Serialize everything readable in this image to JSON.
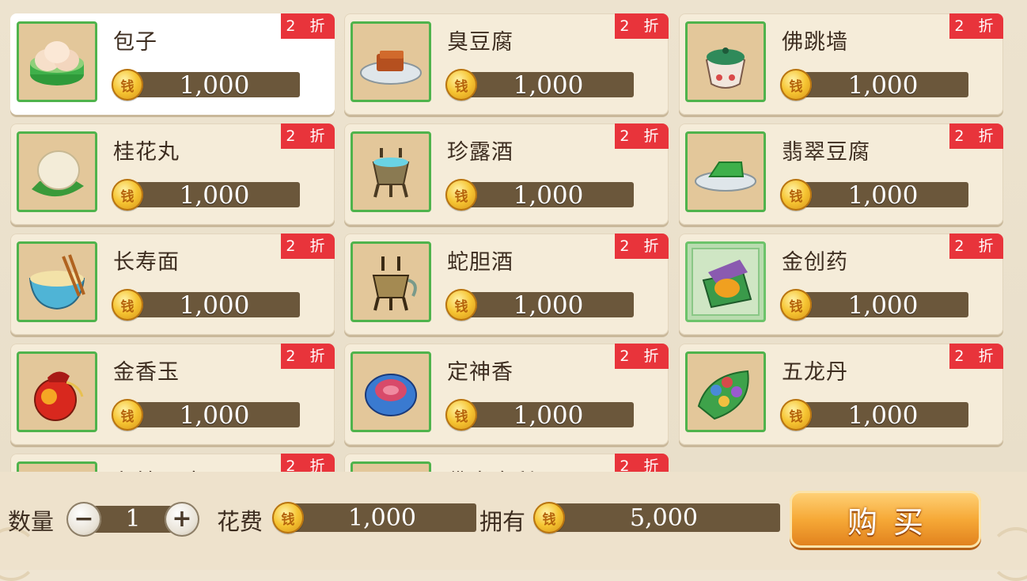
{
  "items": [
    {
      "name": "包子",
      "price": "1,000",
      "discount": "2 折",
      "icon": "steamed-bun-icon",
      "selected": true
    },
    {
      "name": "臭豆腐",
      "price": "1,000",
      "discount": "2 折",
      "icon": "stinky-tofu-icon"
    },
    {
      "name": "佛跳墙",
      "price": "1,000",
      "discount": "2 折",
      "icon": "soup-jar-icon"
    },
    {
      "name": "桂花丸",
      "price": "1,000",
      "discount": "2 折",
      "icon": "rice-ball-icon"
    },
    {
      "name": "珍露酒",
      "price": "1,000",
      "discount": "2 折",
      "icon": "wine-vessel-icon"
    },
    {
      "name": "翡翠豆腐",
      "price": "1,000",
      "discount": "2 折",
      "icon": "jade-tofu-icon"
    },
    {
      "name": "长寿面",
      "price": "1,000",
      "discount": "2 折",
      "icon": "noodle-bowl-icon"
    },
    {
      "name": "蛇胆酒",
      "price": "1,000",
      "discount": "2 折",
      "icon": "bronze-vessel-icon"
    },
    {
      "name": "金创药",
      "price": "1,000",
      "discount": "2 折",
      "icon": "medicine-box-icon"
    },
    {
      "name": "金香玉",
      "price": "1,000",
      "discount": "2 折",
      "icon": "pouch-icon"
    },
    {
      "name": "定神香",
      "price": "1,000",
      "discount": "2 折",
      "icon": "incense-dish-icon"
    },
    {
      "name": "五龙丹",
      "price": "1,000",
      "discount": "2 折",
      "icon": "pills-leaf-icon"
    },
    {
      "name": "九转回魂丹",
      "price": "",
      "discount": "2 折",
      "icon": "partial-item-icon"
    },
    {
      "name": "佛光舍利子",
      "price": "",
      "discount": "2 折",
      "icon": "partial-item-icon"
    }
  ],
  "bottom": {
    "quantity_label": "数量",
    "quantity_value": "1",
    "minus_label": "−",
    "plus_label": "+",
    "cost_label": "花费",
    "cost_value": "1,000",
    "owned_label": "拥有",
    "owned_value": "5,000",
    "buy_label": "购买"
  },
  "coin_glyph": "钱",
  "colors": {
    "badge": "#e8343b",
    "bar": "#6b573b",
    "frame": "#4fb34c",
    "buy": "#f6a937"
  }
}
